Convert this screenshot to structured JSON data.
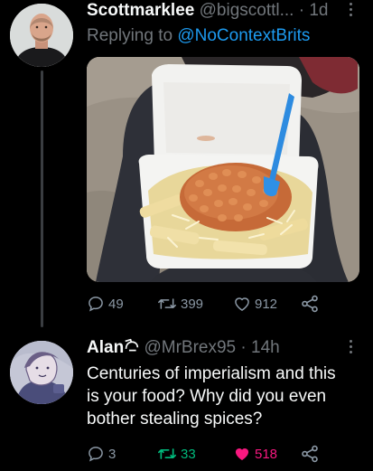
{
  "tweet1": {
    "author_name": "Scottmarklee",
    "handle": "@bigscottl...",
    "separator": "·",
    "time": "1d",
    "replying_prefix": "Replying to ",
    "replying_mention": "@NoContextBrits",
    "stats": {
      "replies": "49",
      "retweets": "399",
      "likes": "912"
    },
    "avatar_icon": "profile-photo-man",
    "photo_icon": "photo-chips-beans-cheese-styrofoam-box"
  },
  "tweet2": {
    "author_name": "Alan",
    "name_emoji_icon": "saluting-emoji-icon",
    "handle": "@MrBrex95",
    "separator": "·",
    "time": "14h",
    "text_lines": [
      "Centuries of imperialism and this",
      "is your food? Why did you even",
      "bother stealing spices?"
    ],
    "stats": {
      "replies": "3",
      "retweets": "33",
      "likes": "518"
    },
    "avatar_icon": "profile-drawing-avatar"
  },
  "colors": {
    "background": "#000000",
    "muted": "#71767b",
    "link": "#1d9bf0",
    "retweet_active": "#00ba7c",
    "like_active": "#f91880"
  }
}
